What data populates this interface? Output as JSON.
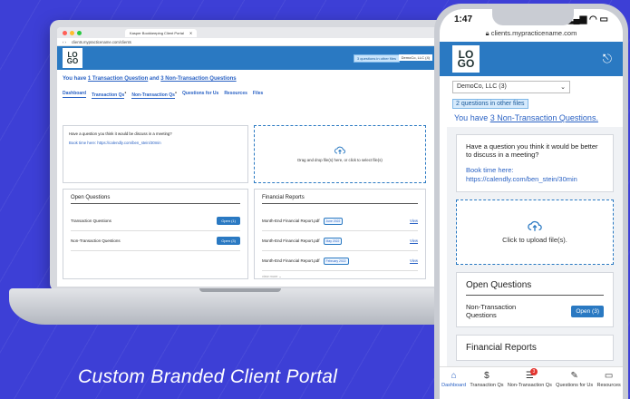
{
  "laptop": {
    "tab_title": "Kasper Bookkeeping Client Portal",
    "url": "clients.mypracticename.com/clients",
    "logo": "LOGO",
    "questions_btn": "3 questions in other files",
    "company_select": "DemoCo, LLC (4)",
    "headline_prefix": "You have ",
    "headline_link1": "1 Transaction Question",
    "headline_mid": " and ",
    "headline_link2": "3 Non-Transaction Questions",
    "nav": [
      "Dashboard",
      "Transaction Qs",
      "Non-Transaction Qs",
      "Questions for Us",
      "Resources",
      "Files"
    ],
    "question_prompt": "Have a question you think it would be discuss in a meeting?",
    "book_time": "Book time here: https://calendly.com/ben_stein/30min",
    "drop_text": "Drag and drop file(s) here, or click to select file(s)",
    "open_questions_title": "Open Questions",
    "open_rows": [
      {
        "label": "Transaction Questions",
        "button": "Open (1)"
      },
      {
        "label": "Non-Transaction Questions",
        "button": "Open (3)"
      }
    ],
    "financial_title": "Financial Reports",
    "reports": [
      {
        "name": "Month-End Financial Report.pdf",
        "tag": "June 2022",
        "action": "View"
      },
      {
        "name": "Month-End Financial Report.pdf",
        "tag": "May 2022",
        "action": "View"
      },
      {
        "name": "Month-End Financial Report.pdf",
        "tag": "February 2022",
        "action": "View"
      }
    ],
    "view_more": "view more"
  },
  "phone": {
    "time": "1:47",
    "url": "clients.mypracticename.com",
    "logo": "LOGO",
    "company_select": "DemoCo, LLC (3)",
    "questions_tag": "2 questions in other files",
    "headline_prefix": "You have ",
    "headline_link": "3 Non-Transaction Questions.",
    "question_prompt": "Have a question you think it would be better to discuss in a meeting?",
    "book_time_label": "Book time here:",
    "book_time_url": "https://calendly.com/ben_stein/30min",
    "upload_text": "Click to upload file(s).",
    "open_questions_title": "Open Questions",
    "open_row_label": "Non-Transaction Questions",
    "open_row_button": "Open (3)",
    "financial_title": "Financial Reports",
    "tabs": [
      {
        "label": "Dashboard",
        "icon": "home-icon"
      },
      {
        "label": "Transaction Qs",
        "icon": "dollar-icon"
      },
      {
        "label": "Non-Transaction Qs",
        "icon": "notes-icon",
        "badge": "3"
      },
      {
        "label": "Questions for Us",
        "icon": "pencil-icon"
      },
      {
        "label": "Resources",
        "icon": "folder-icon"
      }
    ]
  },
  "caption": "Custom Branded Client Portal",
  "colors": {
    "background": "#3d3fd6",
    "brand": "#2a79c2",
    "link": "#2a62c4",
    "badge": "#e3342f"
  }
}
